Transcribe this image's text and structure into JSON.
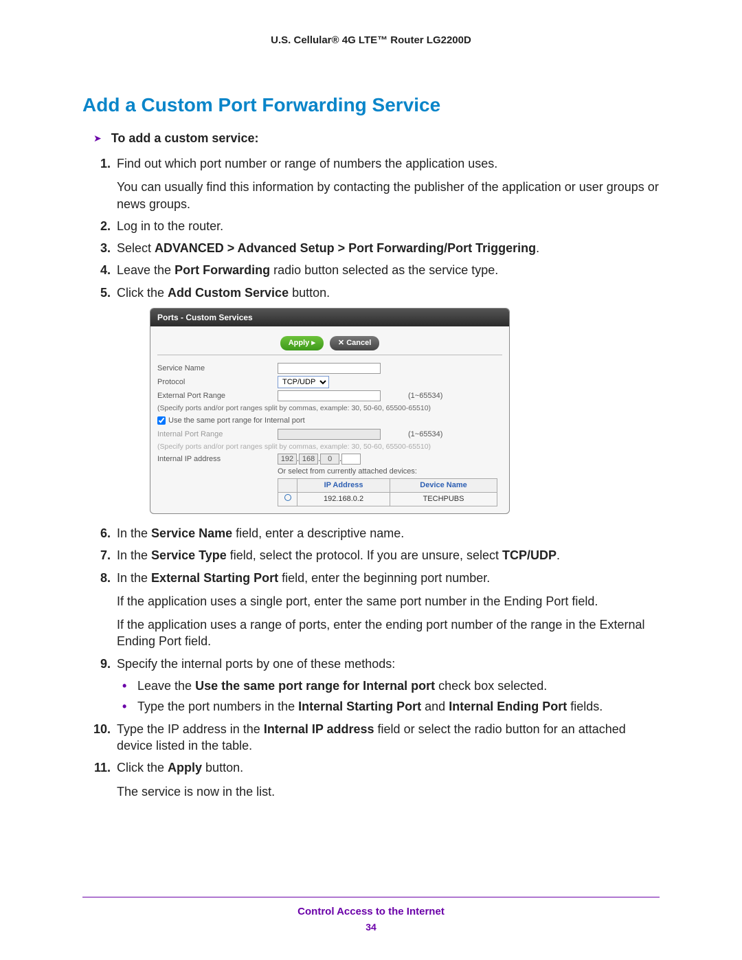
{
  "header": "U.S. Cellular® 4G LTE™ Router LG2200D",
  "title": "Add a Custom Port Forwarding Service",
  "subheading": "To add a custom service:",
  "steps": {
    "s1a": "Find out which port number or range of numbers the application uses.",
    "s1b": "You can usually find this information by contacting the publisher of the application or user groups or news groups.",
    "s2": "Log in to the router.",
    "s3_prefix": "Select ",
    "s3_bold": "ADVANCED > Advanced Setup > Port Forwarding/Port Triggering",
    "s3_suffix": ".",
    "s4_a": "Leave the ",
    "s4_b": "Port Forwarding",
    "s4_c": " radio button selected as the service type.",
    "s5_a": "Click the ",
    "s5_b": "Add Custom Service",
    "s5_c": " button.",
    "s6_a": "In the ",
    "s6_b": "Service Name",
    "s6_c": " field, enter a descriptive name.",
    "s7_a": "In the ",
    "s7_b": "Service Type",
    "s7_c": " field, select the protocol. If you are unsure, select ",
    "s7_d": "TCP/UDP",
    "s7_e": ".",
    "s8_a": "In the ",
    "s8_b": "External Starting Port",
    "s8_c": " field, enter the beginning port number.",
    "s8_p1": "If the application uses a single port, enter the same port number in the Ending Port field.",
    "s8_p2": "If the application uses a range of ports, enter the ending port number of the range in the External Ending Port field.",
    "s9": "Specify the internal ports by one of these methods:",
    "s9_b1_a": "Leave the ",
    "s9_b1_b": "Use the same port range for Internal port",
    "s9_b1_c": " check box selected.",
    "s9_b2_a": "Type the port numbers in the ",
    "s9_b2_b": "Internal Starting Port",
    "s9_b2_c": " and ",
    "s9_b2_d": "Internal Ending Port",
    "s9_b2_e": " fields.",
    "s10_a": "Type the IP address in the ",
    "s10_b": "Internal IP address",
    "s10_c": " field or select the radio button for an attached device listed in the table.",
    "s11_a": "Click the ",
    "s11_b": "Apply",
    "s11_c": " button.",
    "s11_p": "The service is now in the list."
  },
  "panel": {
    "title": "Ports - Custom Services",
    "apply": "Apply ▸",
    "cancel": "✕ Cancel",
    "labels": {
      "service_name": "Service Name",
      "protocol": "Protocol",
      "ext_range": "External Port Range",
      "note": "(Specify ports and/or port ranges split by commas, example: 30, 50-60, 65500-65510)",
      "checkbox": "Use the same port range for Internal port",
      "int_range": "Internal Port Range",
      "int_ip": "Internal IP address",
      "or_select": "Or select from currently attached devices:"
    },
    "protocol_value": "TCP/UDP",
    "range_hint": "(1~65534)",
    "ip": {
      "o1": "192",
      "o2": "168",
      "o3": "0",
      "o4": ""
    },
    "table": {
      "h1": "IP Address",
      "h2": "Device Name",
      "row": {
        "ip": "192.168.0.2",
        "name": "TECHPUBS"
      }
    }
  },
  "footer": {
    "title": "Control Access to the Internet",
    "page": "34"
  }
}
